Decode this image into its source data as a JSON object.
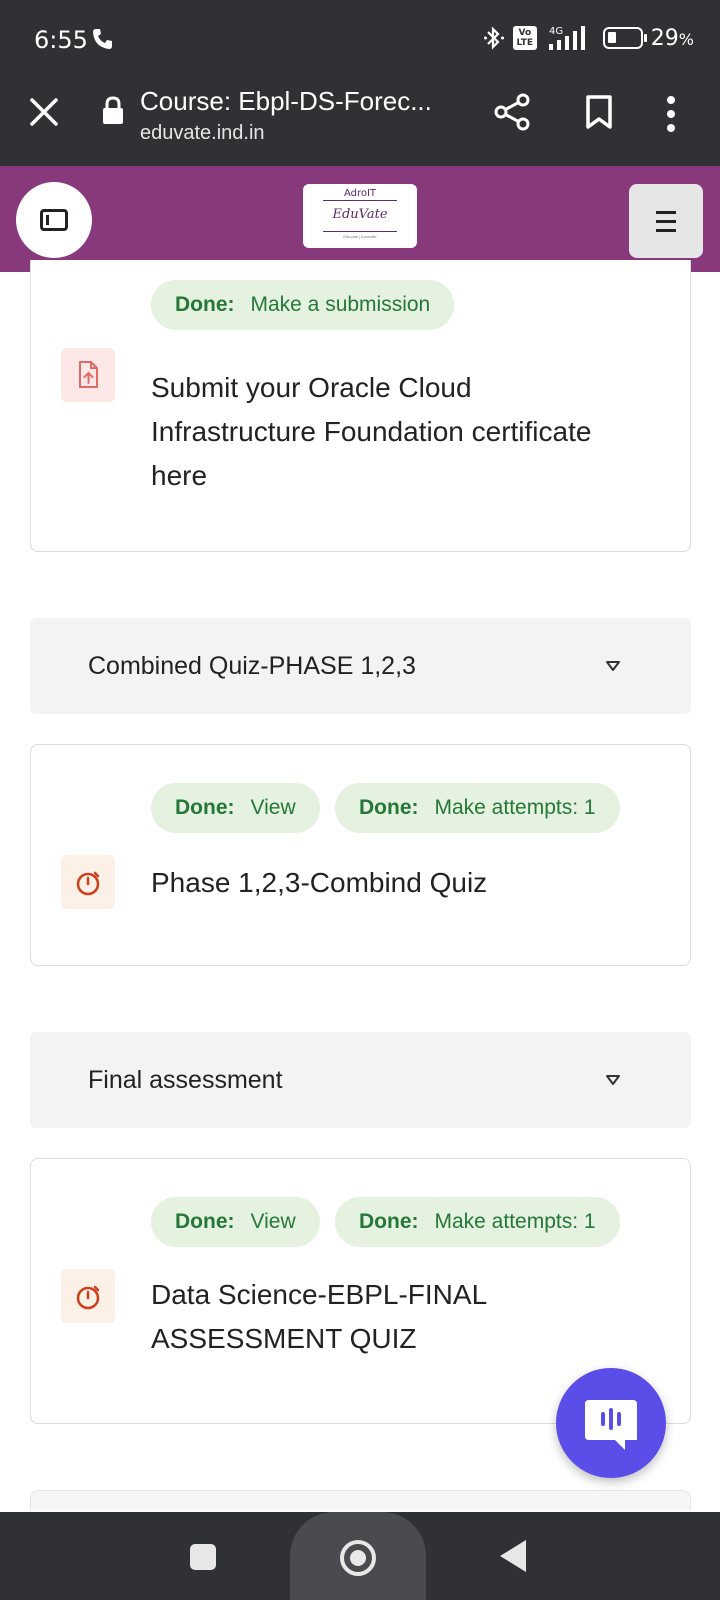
{
  "status_bar": {
    "time": "6:55",
    "volte_top": "Vo",
    "volte_bottom": "LTE",
    "network": "4G",
    "battery_pct": "29",
    "battery_unit": "%"
  },
  "browser": {
    "title": "Course: Ebpl-DS-Forec...",
    "url": "eduvate.ind.in"
  },
  "site_header": {
    "logo_top": "AdroIT",
    "logo_main": "EduVate",
    "logo_tagline": "Educate | Innovate"
  },
  "activities": [
    {
      "type": "assignment",
      "icon": "file-upload-icon",
      "completions": [
        {
          "done_label": "Done:",
          "text": "Make a submission"
        }
      ],
      "title_lines": [
        "Submit your Oracle Cloud",
        "Infrastructure Foundation certificate",
        "here"
      ]
    },
    {
      "type": "quiz",
      "icon": "stopwatch-icon",
      "completions": [
        {
          "done_label": "Done:",
          "text": "View"
        },
        {
          "done_label": "Done:",
          "text": "Make attempts: 1"
        }
      ],
      "title_lines": [
        "Phase 1,2,3-Combind Quiz"
      ]
    },
    {
      "type": "quiz",
      "icon": "stopwatch-icon",
      "completions": [
        {
          "done_label": "Done:",
          "text": "View"
        },
        {
          "done_label": "Done:",
          "text": "Make attempts: 1"
        }
      ],
      "title_lines": [
        "Data Science-EBPL-FINAL",
        "ASSESSMENT QUIZ"
      ]
    }
  ],
  "sections": [
    {
      "title": "Combined Quiz-PHASE 1,2,3"
    },
    {
      "title": "Final assessment"
    }
  ],
  "colors": {
    "header_purple": "#87397c",
    "badge_bg": "#e4f2df",
    "badge_text": "#26773a",
    "chat_fab": "#5b4de8"
  }
}
